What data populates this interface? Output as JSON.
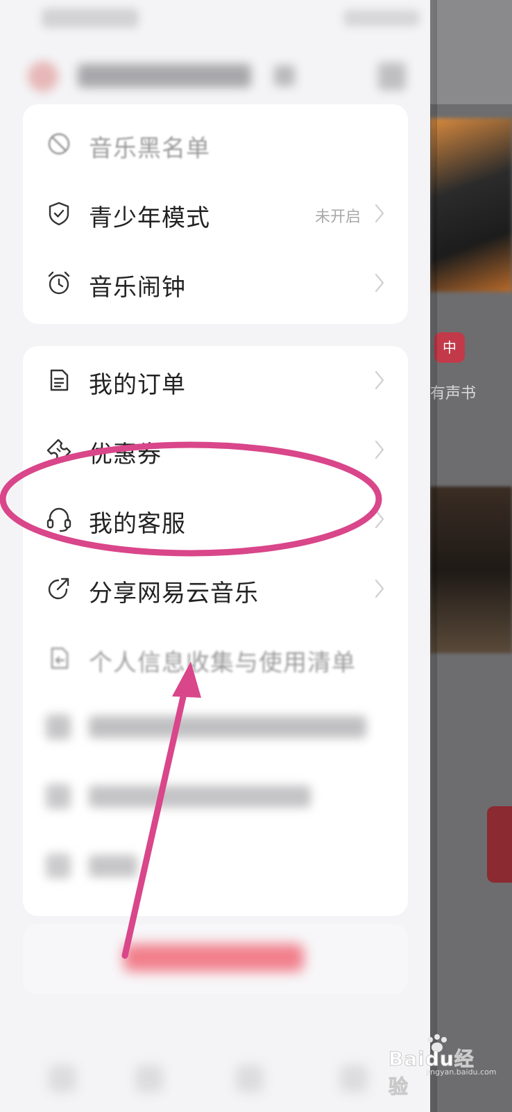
{
  "drawer": {
    "card1": [
      {
        "id": "blacklist",
        "label": "音乐黑名单",
        "icon": "block-icon",
        "status": ""
      },
      {
        "id": "teen-mode",
        "label": "青少年模式",
        "icon": "shield-icon",
        "status": "未开启"
      },
      {
        "id": "alarm",
        "label": "音乐闹钟",
        "icon": "alarm-clock-icon",
        "status": ""
      }
    ],
    "card2": [
      {
        "id": "orders",
        "label": "我的订单",
        "icon": "document-icon"
      },
      {
        "id": "coupons",
        "label": "优惠券",
        "icon": "ticket-icon"
      },
      {
        "id": "customer-service",
        "label": "我的客服",
        "icon": "headset-icon"
      },
      {
        "id": "share",
        "label": "分享网易云音乐",
        "icon": "share-icon"
      },
      {
        "id": "privacy",
        "label": "个人信息收集与使用清单",
        "icon": "file-return-icon"
      }
    ]
  },
  "main_behind": {
    "icon_glyph": "中",
    "label": "有声书"
  },
  "annotation": {
    "color": "#d9468a",
    "highlight_target": "我的客服"
  },
  "watermark": {
    "text": "Baidu经验",
    "sub": "jingyan.baidu.com"
  }
}
